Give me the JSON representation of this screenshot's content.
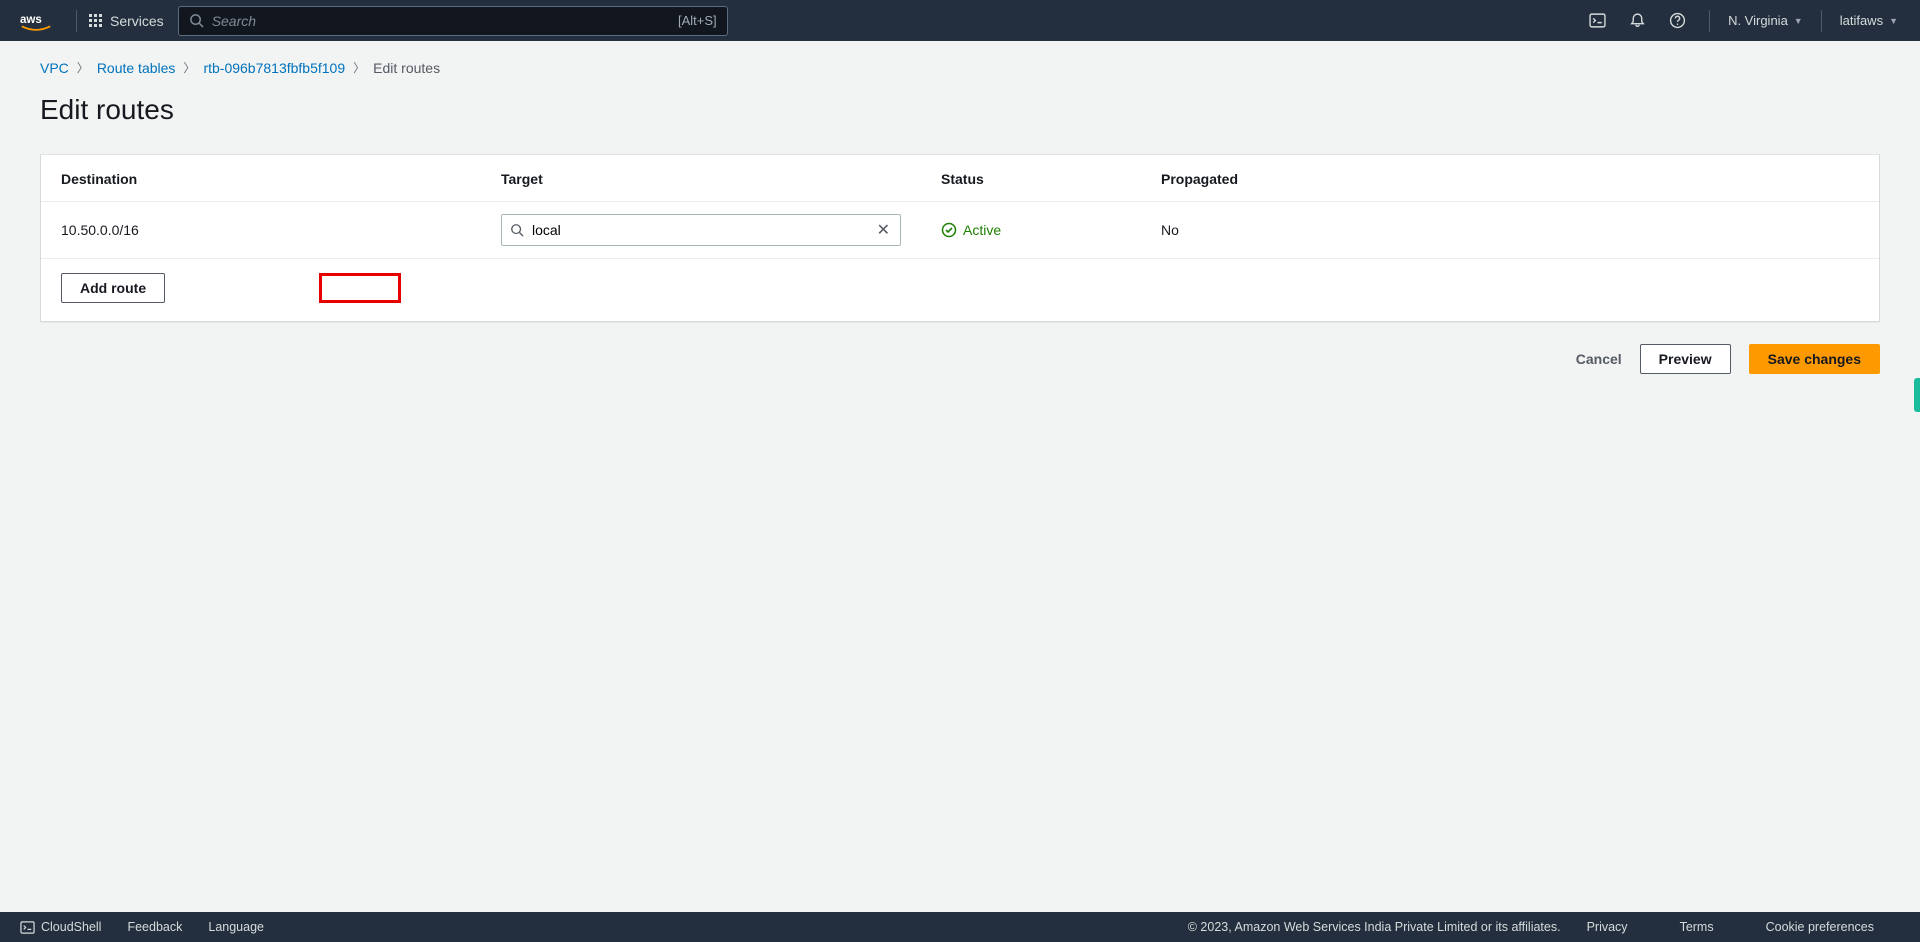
{
  "header": {
    "services_label": "Services",
    "search_placeholder": "Search",
    "search_shortcut": "[Alt+S]",
    "region": "N. Virginia",
    "account": "latifaws"
  },
  "breadcrumb": {
    "vpc": "VPC",
    "route_tables": "Route tables",
    "rtb_id": "rtb-096b7813fbfb5f109",
    "current": "Edit routes"
  },
  "page_title": "Edit routes",
  "table": {
    "headers": {
      "destination": "Destination",
      "target": "Target",
      "status": "Status",
      "propagated": "Propagated"
    },
    "rows": [
      {
        "destination": "10.50.0.0/16",
        "target": "local",
        "status": "Active",
        "propagated": "No"
      }
    ]
  },
  "buttons": {
    "add_route": "Add route",
    "cancel": "Cancel",
    "preview": "Preview",
    "save": "Save changes"
  },
  "footer": {
    "cloudshell": "CloudShell",
    "feedback": "Feedback",
    "language": "Language",
    "copyright": "© 2023, Amazon Web Services India Private Limited or its affiliates.",
    "privacy": "Privacy",
    "terms": "Terms",
    "cookie": "Cookie preferences"
  }
}
